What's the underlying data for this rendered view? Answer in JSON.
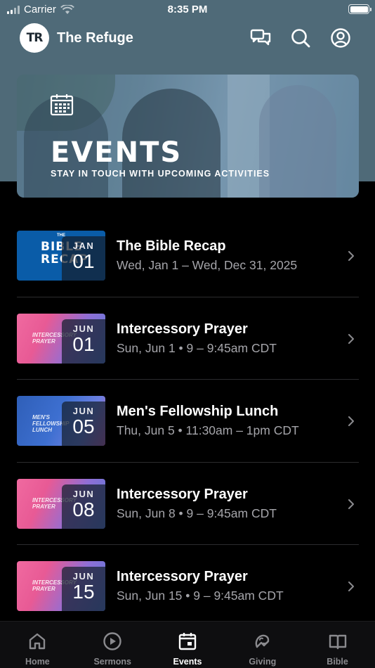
{
  "status_bar": {
    "carrier": "Carrier",
    "time": "8:35 PM"
  },
  "header": {
    "logo_text": "TR",
    "title": "The Refuge",
    "icons": [
      "chat-icon",
      "search-icon",
      "profile-icon"
    ]
  },
  "hero": {
    "title": "EVENTS",
    "subtitle": "STAY IN TOUCH WITH UPCOMING ACTIVITIES",
    "icon": "calendar-icon"
  },
  "events": [
    {
      "title": "The Bible Recap",
      "date": "Wed, Jan 1 – Wed, Dec 31, 2025",
      "month": "JAN",
      "day": "01",
      "thumb_style": "bible",
      "thumb_text": "BIBLE RECAP",
      "thumb_small": "THE"
    },
    {
      "title": "Intercessory Prayer",
      "date": "Sun, Jun 1 • 9 – 9:45am CDT",
      "month": "JUN",
      "day": "01",
      "thumb_style": "pink",
      "thumb_text": "INTERCESSORY PRAYER"
    },
    {
      "title": "Men's Fellowship Lunch",
      "date": "Thu, Jun 5 • 11:30am – 1pm CDT",
      "month": "JUN",
      "day": "05",
      "thumb_style": "blue",
      "thumb_text": "MEN'S FELLOWSHIP LUNCH"
    },
    {
      "title": "Intercessory Prayer",
      "date": "Sun, Jun 8 • 9 – 9:45am CDT",
      "month": "JUN",
      "day": "08",
      "thumb_style": "pink",
      "thumb_text": "INTERCESSORY PRAYER"
    },
    {
      "title": "Intercessory Prayer",
      "date": "Sun, Jun 15 • 9 – 9:45am CDT",
      "month": "JUN",
      "day": "15",
      "thumb_style": "pink",
      "thumb_text": "INTERCESSORY PRAYER"
    }
  ],
  "tabs": [
    {
      "label": "Home",
      "icon": "home-icon",
      "active": false
    },
    {
      "label": "Sermons",
      "icon": "play-icon",
      "active": false
    },
    {
      "label": "Events",
      "icon": "calendar-icon",
      "active": true
    },
    {
      "label": "Giving",
      "icon": "giving-icon",
      "active": false
    },
    {
      "label": "Bible",
      "icon": "book-icon",
      "active": false
    }
  ],
  "colors": {
    "header_bg": "#4f6a78",
    "background": "#000000",
    "secondary_text": "#a5a5aa",
    "inactive_tab": "#8a8a8e"
  }
}
